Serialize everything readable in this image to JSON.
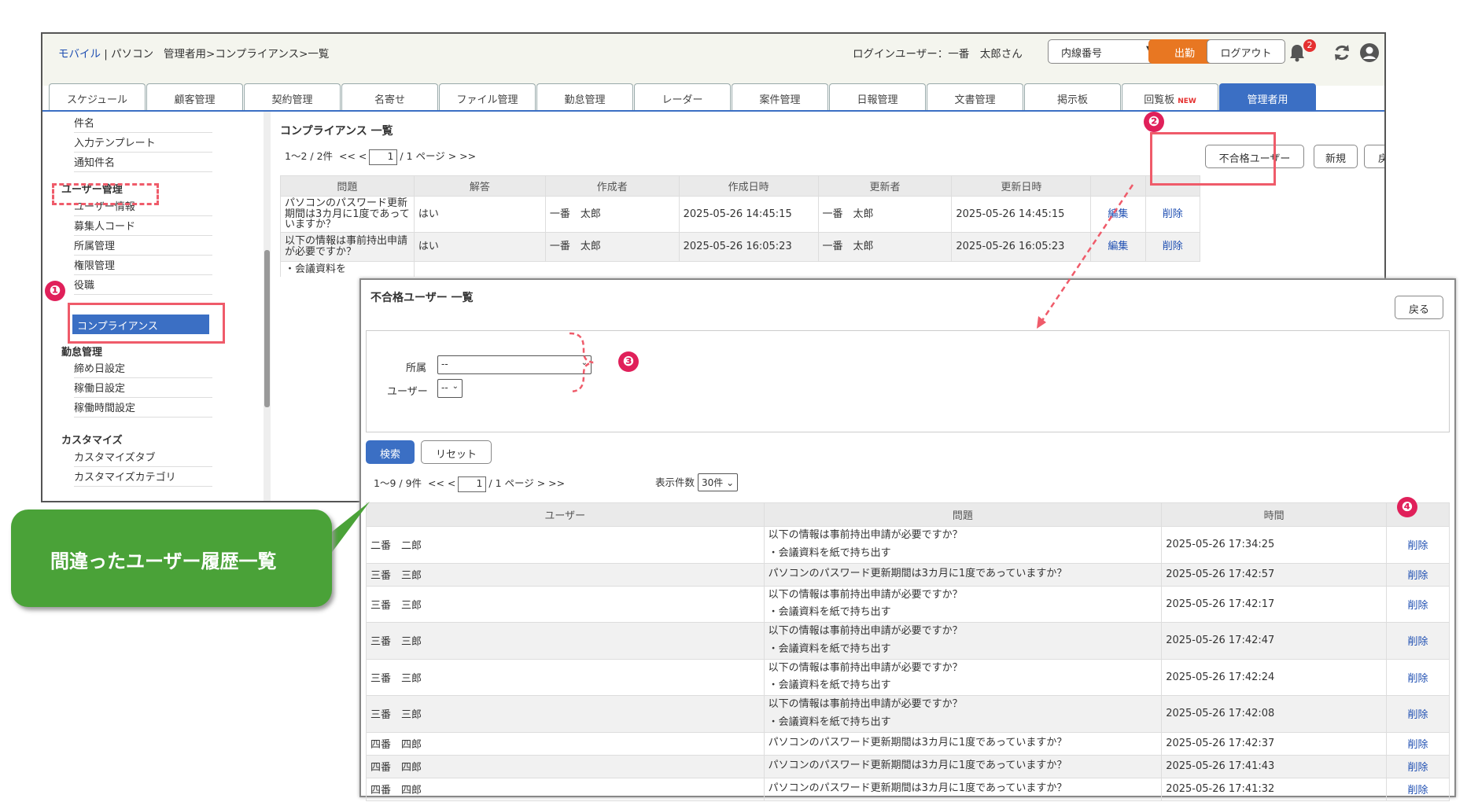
{
  "header": {
    "brand_mobile": "モバイル",
    "brand_sep": " | ",
    "brand_pc": "パソコン",
    "breadcrumb": "管理者用>コンプライアンス>一覧",
    "login_user": "ログインユーザー：一番　太郎さん",
    "extension_label": "内線番号",
    "extension_arrow": "▼",
    "work_button": "出勤",
    "logout_button": "ログアウト",
    "notification_count": "2"
  },
  "tabs": [
    {
      "label": "スケジュール"
    },
    {
      "label": "顧客管理"
    },
    {
      "label": "契約管理"
    },
    {
      "label": "名寄せ"
    },
    {
      "label": "ファイル管理"
    },
    {
      "label": "勤怠管理"
    },
    {
      "label": "レーダー"
    },
    {
      "label": "案件管理"
    },
    {
      "label": "日報管理"
    },
    {
      "label": "文書管理"
    },
    {
      "label": "掲示板"
    },
    {
      "label": "回覧板",
      "badge": "NEW"
    },
    {
      "label": "管理者用",
      "active": true
    }
  ],
  "sidebar": {
    "items_top": [
      "件名",
      "入力テンプレート",
      "通知件名"
    ],
    "section_user": "ユーザー管理",
    "items_user": [
      "ユーザー情報",
      "募集人コード",
      "所属管理",
      "権限管理",
      "役職"
    ],
    "active_item": "コンプライアンス",
    "section_attendance": "勤怠管理",
    "items_attendance": [
      "締め日設定",
      "稼働日設定",
      "稼働時間設定"
    ],
    "section_custom": "カスタマイズ",
    "items_custom": [
      "カスタマイズタブ",
      "カスタマイズカテゴリ"
    ]
  },
  "main": {
    "title": "コンプライアンス 一覧",
    "pager": {
      "prefix": "1～2 / 2件",
      "nav_prev": "<< <",
      "page": "1",
      "suffix": "/ 1 ページ > >>"
    },
    "btn_fail_users": "不合格ユーザー",
    "btn_new": "新規",
    "btn_back": "戻る",
    "columns": [
      "問題",
      "解答",
      "作成者",
      "作成日時",
      "更新者",
      "更新日時",
      "",
      ""
    ],
    "rows": [
      {
        "question": "パソコンのパスワード更新期間は3カ月に1度であっていますか？",
        "answer": "はい",
        "creator": "一番　太郎",
        "created": "2025-05-26 14:45:15",
        "updater": "一番　太郎",
        "updated": "2025-05-26 14:45:15",
        "edit": "編集",
        "delete": "削除"
      },
      {
        "question": "以下の情報は事前持出申請が必要ですか？",
        "answer": "はい",
        "creator": "一番　太郎",
        "created": "2025-05-26 16:05:23",
        "updater": "一番　太郎",
        "updated": "2025-05-26 16:05:23",
        "edit": "編集",
        "delete": "削除"
      }
    ],
    "partial_line": "・会議資料を"
  },
  "overlay": {
    "title": "不合格ユーザー 一覧",
    "back_button": "戻る",
    "filter_dept_label": "所属",
    "filter_dept_value": "--",
    "filter_user_label": "ユーザー",
    "filter_user_value": "--",
    "search_button": "検索",
    "reset_button": "リセット",
    "pager": {
      "prefix": "1～9 / 9件",
      "nav_prev": "<< <",
      "page": "1",
      "suffix": "/ 1 ページ > >>"
    },
    "per_page_label": "表示件数",
    "per_page_value": "30件",
    "columns": [
      "ユーザー",
      "問題",
      "時間",
      ""
    ],
    "rows": [
      {
        "user": "二番　二郎",
        "q1": "以下の情報は事前持出申請が必要ですか？",
        "q2": "・会議資料を紙で持ち出す",
        "time": "2025-05-26 17:34:25",
        "del": "削除"
      },
      {
        "user": "三番　三郎",
        "q1": "パソコンのパスワード更新期間は3カ月に1度であっていますか？",
        "q2": "",
        "time": "2025-05-26 17:42:57",
        "del": "削除"
      },
      {
        "user": "三番　三郎",
        "q1": "以下の情報は事前持出申請が必要ですか？",
        "q2": "・会議資料を紙で持ち出す",
        "time": "2025-05-26 17:42:17",
        "del": "削除"
      },
      {
        "user": "三番　三郎",
        "q1": "以下の情報は事前持出申請が必要ですか？",
        "q2": "・会議資料を紙で持ち出す",
        "time": "2025-05-26 17:42:47",
        "del": "削除"
      },
      {
        "user": "三番　三郎",
        "q1": "以下の情報は事前持出申請が必要ですか？",
        "q2": "・会議資料を紙で持ち出す",
        "time": "2025-05-26 17:42:24",
        "del": "削除"
      },
      {
        "user": "三番　三郎",
        "q1": "以下の情報は事前持出申請が必要ですか？",
        "q2": "・会議資料を紙で持ち出す",
        "time": "2025-05-26 17:42:08",
        "del": "削除"
      },
      {
        "user": "四番　四郎",
        "q1": "パソコンのパスワード更新期間は3カ月に1度であっていますか？",
        "q2": "",
        "time": "2025-05-26 17:42:37",
        "del": "削除"
      },
      {
        "user": "四番　四郎",
        "q1": "パソコンのパスワード更新期間は3カ月に1度であっていますか？",
        "q2": "",
        "time": "2025-05-26 17:41:43",
        "del": "削除"
      },
      {
        "user": "四番　四郎",
        "q1": "パソコンのパスワード更新期間は3カ月に1度であっていますか？",
        "q2": "",
        "time": "2025-05-26 17:41:32",
        "del": "削除"
      }
    ]
  },
  "annotations": {
    "callout_text": "間違ったユーザー履歴一覧",
    "markers": [
      "❶",
      "❷",
      "❸",
      "❹"
    ]
  },
  "colors": {
    "accent": "#3b6fc4",
    "work": "#e87722",
    "callout": "#4aa238",
    "marker": "#e0205a",
    "highlight": "#ef5b6a"
  }
}
